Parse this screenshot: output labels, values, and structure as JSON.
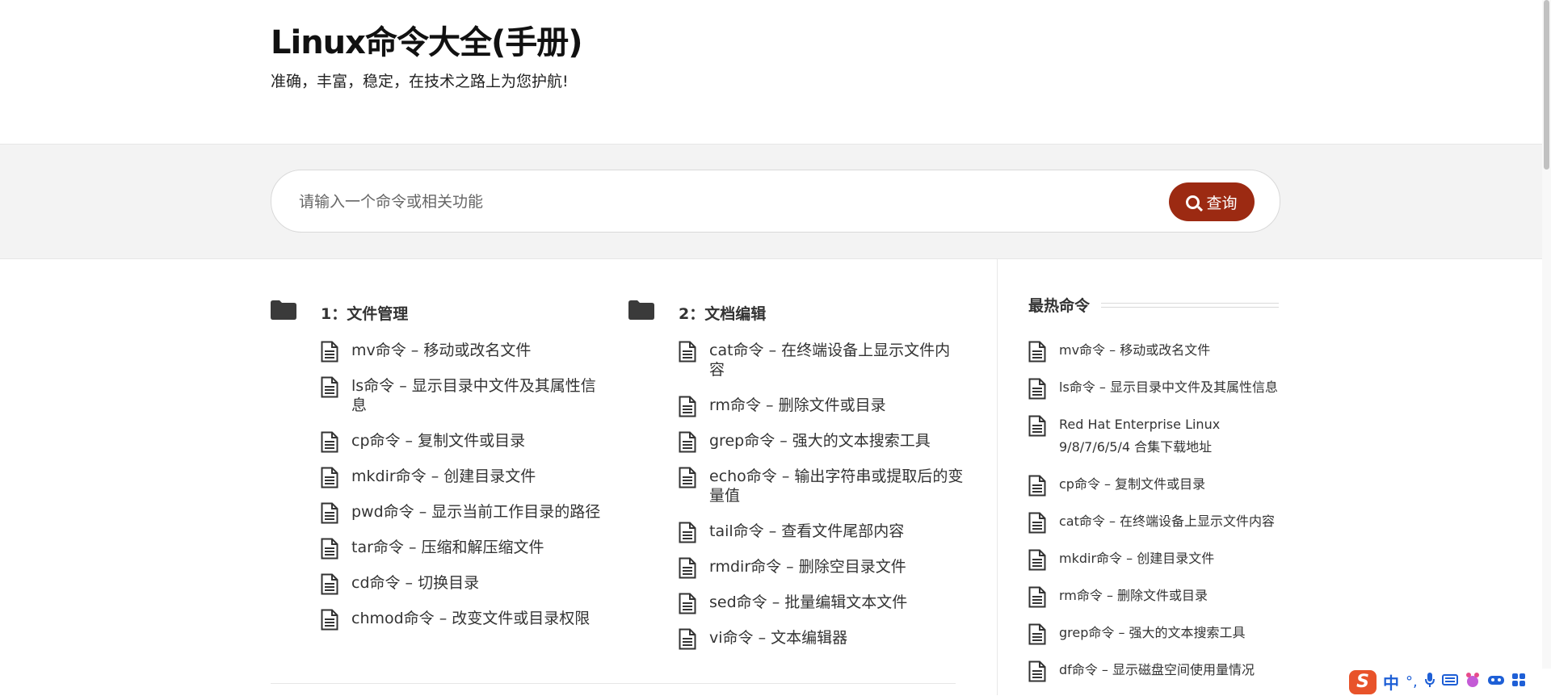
{
  "site": {
    "title": "Linux命令大全(手册)",
    "tagline": "准确，丰富，稳定，在技术之路上为您护航!"
  },
  "search": {
    "placeholder": "请输入一个命令或相关功能",
    "button_label": "查询"
  },
  "categories": [
    {
      "title": "1：文件管理",
      "items": [
        "mv命令 – 移动或改名文件",
        "ls命令 – 显示目录中文件及其属性信息",
        "cp命令 – 复制文件或目录",
        "mkdir命令 – 创建目录文件",
        "pwd命令 – 显示当前工作目录的路径",
        "tar命令 – 压缩和解压缩文件",
        "cd命令 – 切换目录",
        "chmod命令 – 改变文件或目录权限"
      ]
    },
    {
      "title": "2：文档编辑",
      "items": [
        "cat命令 – 在终端设备上显示文件内容",
        "rm命令 – 删除文件或目录",
        "grep命令 – 强大的文本搜索工具",
        "echo命令 – 输出字符串或提取后的变量值",
        "tail命令 – 查看文件尾部内容",
        "rmdir命令 – 删除空目录文件",
        "sed命令 – 批量编辑文本文件",
        "vi命令 – 文本编辑器"
      ]
    }
  ],
  "sidebar": {
    "title": "最热命令",
    "items": [
      "mv命令 – 移动或改名文件",
      "ls命令 – 显示目录中文件及其属性信息",
      "Red Hat Enterprise Linux 9/8/7/6/5/4 合集下载地址",
      "cp命令 – 复制文件或目录",
      "cat命令 – 在终端设备上显示文件内容",
      "mkdir命令 – 创建目录文件",
      "rm命令 – 删除文件或目录",
      "grep命令 – 强大的文本搜索工具",
      "df命令 – 显示磁盘空间使用量情况"
    ]
  },
  "ime": {
    "logo": "S",
    "mode": "中",
    "punct": "°,"
  },
  "colors": {
    "accent": "#9c2a12",
    "band": "#f3f3f3"
  },
  "icons": {
    "folder": "folder-icon",
    "document": "document-icon",
    "search": "search-icon"
  }
}
